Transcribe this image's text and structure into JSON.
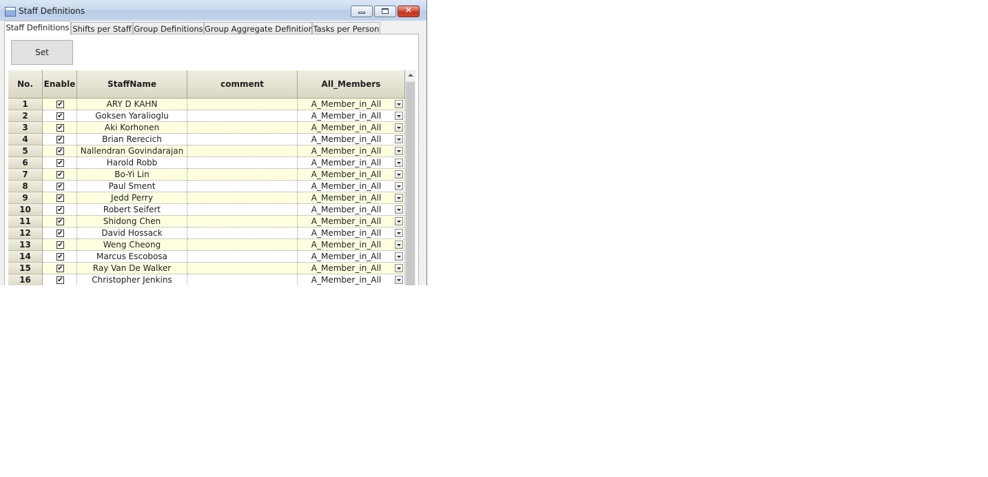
{
  "window": {
    "title": "Staff Definitions"
  },
  "tabs": [
    {
      "label": "Staff Definitions",
      "active": true
    },
    {
      "label": "Shifts per Staff",
      "active": false
    },
    {
      "label": "Group Definitions",
      "active": false
    },
    {
      "label": "Group Aggregate Definitions",
      "active": false
    },
    {
      "label": "Tasks per Person",
      "active": false
    }
  ],
  "toolbar": {
    "set_label": "Set"
  },
  "grid": {
    "columns": [
      "No.",
      "Enable",
      "StaffName",
      "comment",
      "All_Members"
    ],
    "rows": [
      {
        "no": "1",
        "enabled": true,
        "name": "ARY D KAHN",
        "comment": "",
        "all_members": "A_Member_in_All"
      },
      {
        "no": "2",
        "enabled": true,
        "name": "Goksen Yaralioglu",
        "comment": "",
        "all_members": "A_Member_in_All"
      },
      {
        "no": "3",
        "enabled": true,
        "name": "Aki Korhonen",
        "comment": "",
        "all_members": "A_Member_in_All"
      },
      {
        "no": "4",
        "enabled": true,
        "name": "Brian Rerecich",
        "comment": "",
        "all_members": "A_Member_in_All"
      },
      {
        "no": "5",
        "enabled": true,
        "name": "Nallendran Govindarajan",
        "comment": "",
        "all_members": "A_Member_in_All"
      },
      {
        "no": "6",
        "enabled": true,
        "name": "Harold Robb",
        "comment": "",
        "all_members": "A_Member_in_All"
      },
      {
        "no": "7",
        "enabled": true,
        "name": "Bo-Yi Lin",
        "comment": "",
        "all_members": "A_Member_in_All"
      },
      {
        "no": "8",
        "enabled": true,
        "name": "Paul Sment",
        "comment": "",
        "all_members": "A_Member_in_All"
      },
      {
        "no": "9",
        "enabled": true,
        "name": "Jedd Perry",
        "comment": "",
        "all_members": "A_Member_in_All"
      },
      {
        "no": "10",
        "enabled": true,
        "name": "Robert Seifert",
        "comment": "",
        "all_members": "A_Member_in_All"
      },
      {
        "no": "11",
        "enabled": true,
        "name": "Shidong Chen",
        "comment": "",
        "all_members": "A_Member_in_All"
      },
      {
        "no": "12",
        "enabled": true,
        "name": "David Hossack",
        "comment": "",
        "all_members": "A_Member_in_All"
      },
      {
        "no": "13",
        "enabled": true,
        "name": "Weng Cheong",
        "comment": "",
        "all_members": "A_Member_in_All"
      },
      {
        "no": "14",
        "enabled": true,
        "name": "Marcus Escobosa",
        "comment": "",
        "all_members": "A_Member_in_All"
      },
      {
        "no": "15",
        "enabled": true,
        "name": "Ray Van De Walker",
        "comment": "",
        "all_members": "A_Member_in_All"
      },
      {
        "no": "16",
        "enabled": true,
        "name": "Christopher Jenkins",
        "comment": "",
        "all_members": "A_Member_in_All"
      }
    ]
  },
  "colors": {
    "row_even": "#ffffe0",
    "row_odd": "#ffffff",
    "header_bg": "#e4e1cf",
    "close_button": "#c4301b"
  },
  "icons": {
    "app": "window-icon",
    "check": "✔"
  }
}
